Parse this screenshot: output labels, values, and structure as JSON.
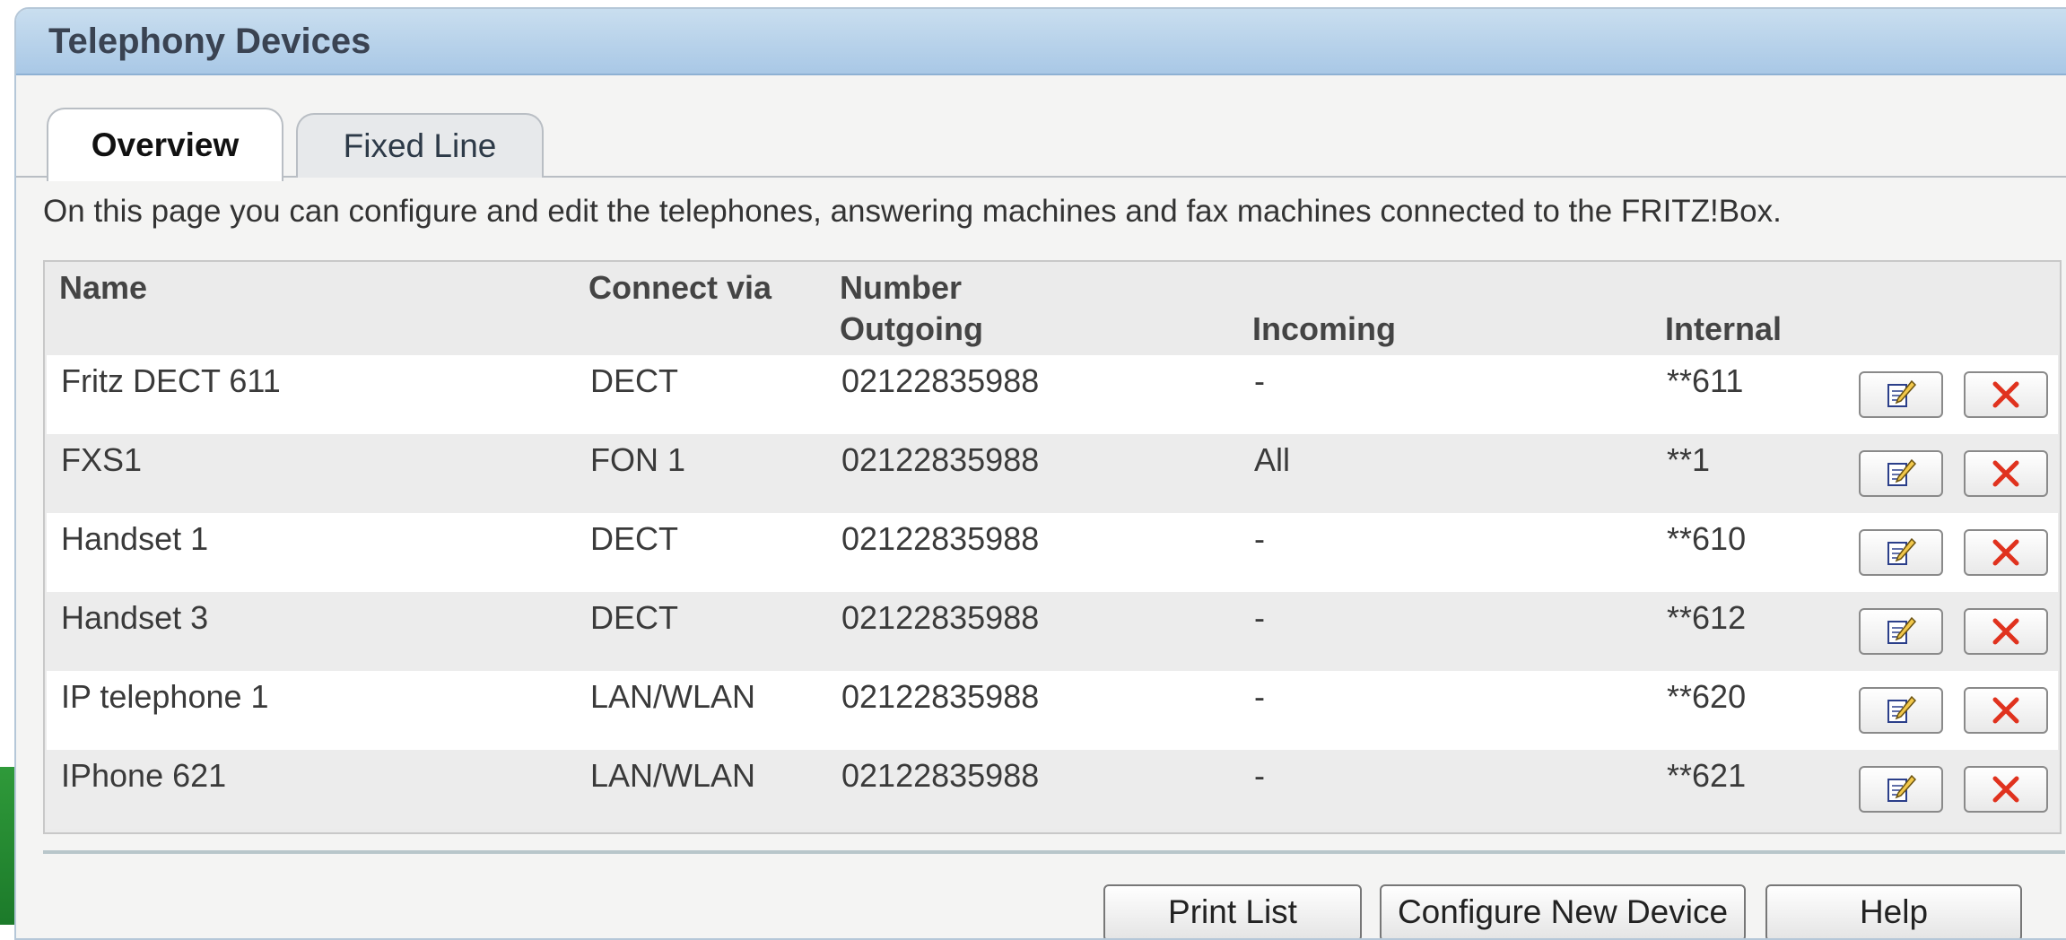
{
  "window": {
    "title": "Telephony Devices"
  },
  "tabs": [
    {
      "label": "Overview",
      "active": true
    },
    {
      "label": "Fixed Line",
      "active": false
    }
  ],
  "description": "On this page you can configure and edit the telephones, answering machines and fax machines connected to the FRITZ!Box.",
  "table": {
    "headers": {
      "name": "Name",
      "connect_via": "Connect via",
      "number_group": "Number",
      "outgoing": "Outgoing",
      "incoming": "Incoming",
      "internal": "Internal"
    },
    "rows": [
      {
        "name": "Fritz DECT 611",
        "connect_via": "DECT",
        "outgoing": "02122835988",
        "incoming": "-",
        "internal": "**611"
      },
      {
        "name": "FXS1",
        "connect_via": "FON 1",
        "outgoing": "02122835988",
        "incoming": "All",
        "internal": "**1"
      },
      {
        "name": "Handset 1",
        "connect_via": "DECT",
        "outgoing": "02122835988",
        "incoming": "-",
        "internal": "**610"
      },
      {
        "name": "Handset 3",
        "connect_via": "DECT",
        "outgoing": "02122835988",
        "incoming": "-",
        "internal": "**612"
      },
      {
        "name": "IP telephone 1",
        "connect_via": "LAN/WLAN",
        "outgoing": "02122835988",
        "incoming": "-",
        "internal": "**620"
      },
      {
        "name": "IPhone 621",
        "connect_via": "LAN/WLAN",
        "outgoing": "02122835988",
        "incoming": "-",
        "internal": "**621"
      }
    ],
    "row_actions": {
      "edit_icon": "edit-icon",
      "delete_icon": "delete-icon"
    }
  },
  "buttons": {
    "print_list": "Print List",
    "configure_new_device": "Configure New Device",
    "help": "Help"
  },
  "colors": {
    "title_bar": "#b4d0ea",
    "delete_red": "#e0321e",
    "row_alt": "#ececec"
  }
}
